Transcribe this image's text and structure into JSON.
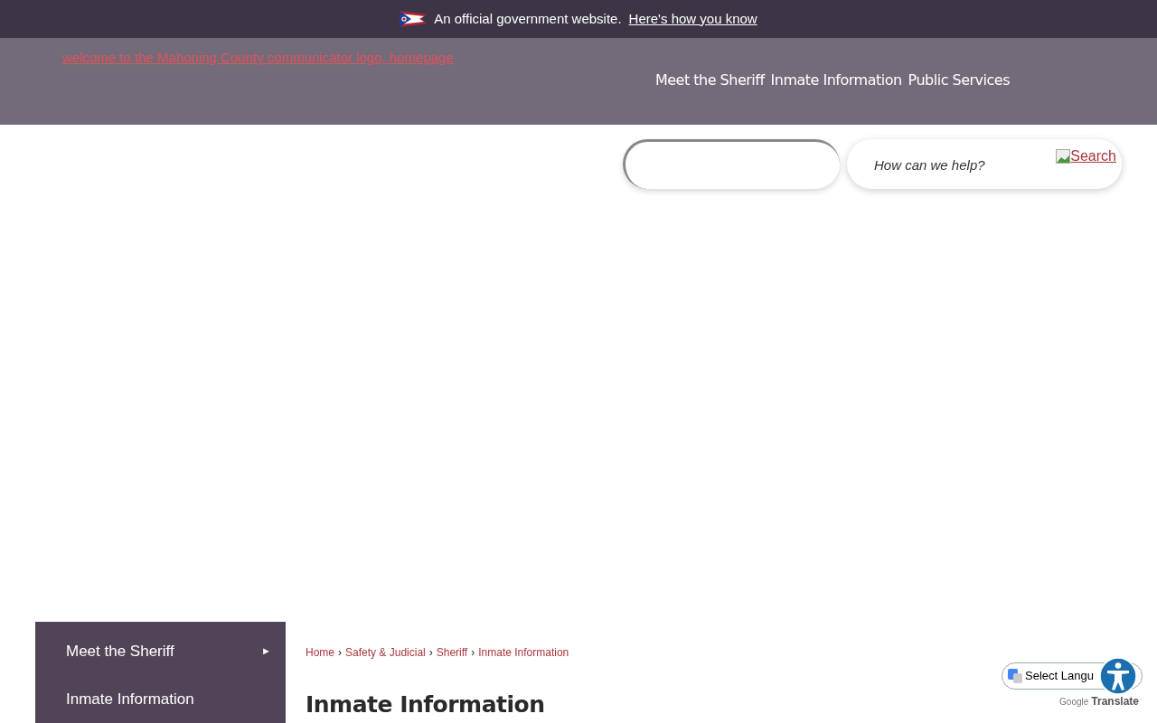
{
  "gov_banner": {
    "text": "An official government website.",
    "link": "Here's how you know"
  },
  "header": {
    "logo_alt": "welcome to the Mahoning County communicator logo, homepage",
    "nav": [
      {
        "label": "Meet the Sheriff"
      },
      {
        "label": "Inmate Information"
      },
      {
        "label": "Public Services"
      }
    ]
  },
  "search": {
    "placeholder": "How can we help?",
    "button_alt": "Search"
  },
  "sidebar": {
    "items": [
      {
        "label": "Meet the Sheriff",
        "arrow": "►"
      },
      {
        "label": "Inmate Information"
      }
    ]
  },
  "breadcrumb": {
    "separator": "›",
    "items": [
      "Home",
      "Safety & Judicial",
      "Sheriff",
      "Inmate Information"
    ]
  },
  "page_title": "Inmate Information",
  "translate": {
    "select": "Select Langu",
    "brand": "Google",
    "label": "Translate"
  }
}
